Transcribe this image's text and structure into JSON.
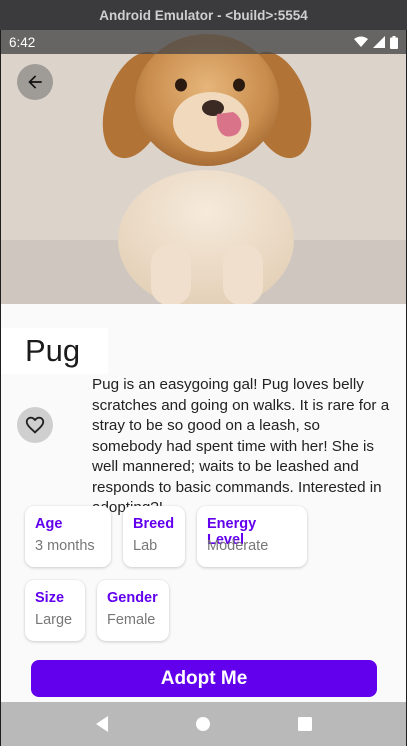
{
  "window": {
    "title": "Android Emulator - <build>:5554"
  },
  "status_bar": {
    "time": "6:42"
  },
  "hero": {
    "alt": "golden retriever puppy"
  },
  "pet": {
    "name": "Pug",
    "description": "Pug is an easygoing gal! Pug loves belly scratches and going on walks. It is rare for a stray to be so good on a leash, so somebody had spent time with her! She is well mannered; waits to be leashed and responds to basic commands. Interested in adopting?!"
  },
  "attributes": [
    {
      "label": "Age",
      "value": "3 months"
    },
    {
      "label": "Breed",
      "value": "Lab"
    },
    {
      "label": "Energy Level",
      "value": "Moderate"
    },
    {
      "label": "Size",
      "value": "Large"
    },
    {
      "label": "Gender",
      "value": "Female"
    }
  ],
  "actions": {
    "adopt_label": "Adopt Me"
  },
  "colors": {
    "accent": "#6200ee",
    "nav_bar": "#b9b9b9",
    "title_bar": "#3b3b3d"
  }
}
